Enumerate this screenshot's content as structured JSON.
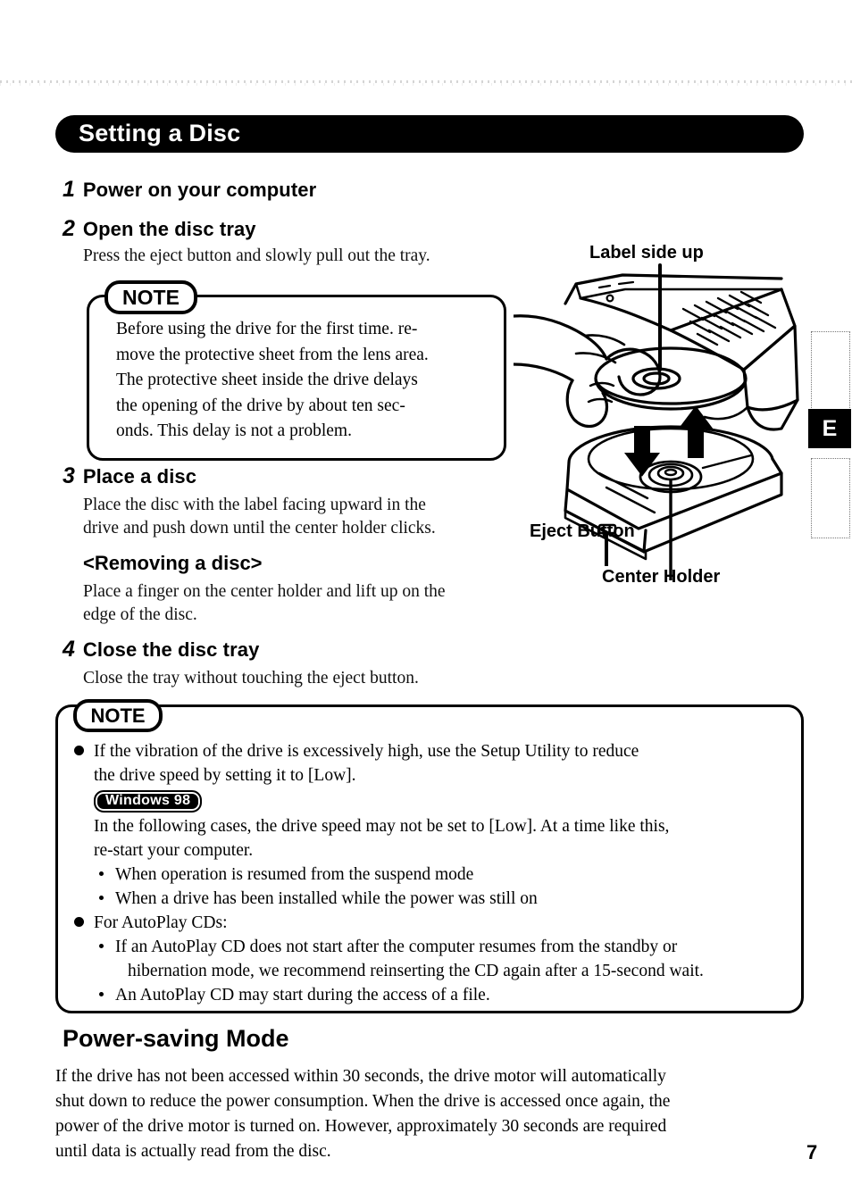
{
  "header": {
    "title": "Setting a Disc"
  },
  "steps": [
    {
      "num": "1",
      "heading": "Power on your computer",
      "body": []
    },
    {
      "num": "2",
      "heading": "Open the disc tray",
      "body": [
        "Press the eject button and slowly pull out the tray."
      ]
    },
    {
      "num": "3",
      "heading": "Place a disc",
      "body": [
        "Place the disc with the label facing upward in the",
        "drive and push down until the center holder clicks."
      ]
    },
    {
      "num": "4",
      "heading": "Close the disc tray",
      "body": [
        "Close the tray without touching the eject button."
      ]
    }
  ],
  "removing": {
    "heading": "<Removing a disc>",
    "body": [
      "Place a finger on the center holder and lift up on the",
      "edge of the disc."
    ]
  },
  "note1": {
    "tag": "NOTE",
    "lines": [
      "Before using the drive for the first time. re-",
      "move the protective sheet from the lens area.",
      "The protective sheet inside the drive delays",
      "the opening of the drive by about ten sec-",
      "onds. This delay is not a problem."
    ]
  },
  "note2": {
    "tag": "NOTE",
    "bullet1": {
      "lines": [
        "If the vibration of the drive is excessively high, use the Setup Utility to reduce",
        "the drive speed by setting it to [Low]."
      ],
      "badge": "Windows 98",
      "after_badge": [
        "In the following cases, the drive speed may not be set to [Low].  At a time like this,",
        "re-start your computer."
      ],
      "sub_items": [
        [
          "When operation is resumed from the suspend mode"
        ],
        [
          "When a drive has been installed while the power was still on"
        ]
      ]
    },
    "bullet2": {
      "lines": [
        "For AutoPlay CDs:"
      ],
      "sub_items": [
        [
          "If an AutoPlay CD does not start after the computer resumes from the standby or",
          "hibernation mode, we recommend reinserting the CD again after a 15-second wait."
        ],
        [
          "An AutoPlay CD may start during the access of a file."
        ]
      ]
    }
  },
  "power_saving": {
    "heading": "Power-saving Mode",
    "lines": [
      "If the drive has not been accessed within 30 seconds, the drive motor will automatically",
      "shut down to reduce the power consumption.  When the drive is accessed once again, the",
      "power of the drive motor is turned on.  However, approximately 30 seconds are required",
      "until data is actually read from the disc."
    ]
  },
  "figure": {
    "labels": {
      "label_side_up": "Label side up",
      "eject_button": "Eject Button",
      "center_holder": "Center Holder"
    }
  },
  "index_tab": {
    "letter": "E"
  },
  "footer": {
    "page_number": "7"
  },
  "colors": {
    "ink": "#000000",
    "paper": "#ffffff"
  }
}
